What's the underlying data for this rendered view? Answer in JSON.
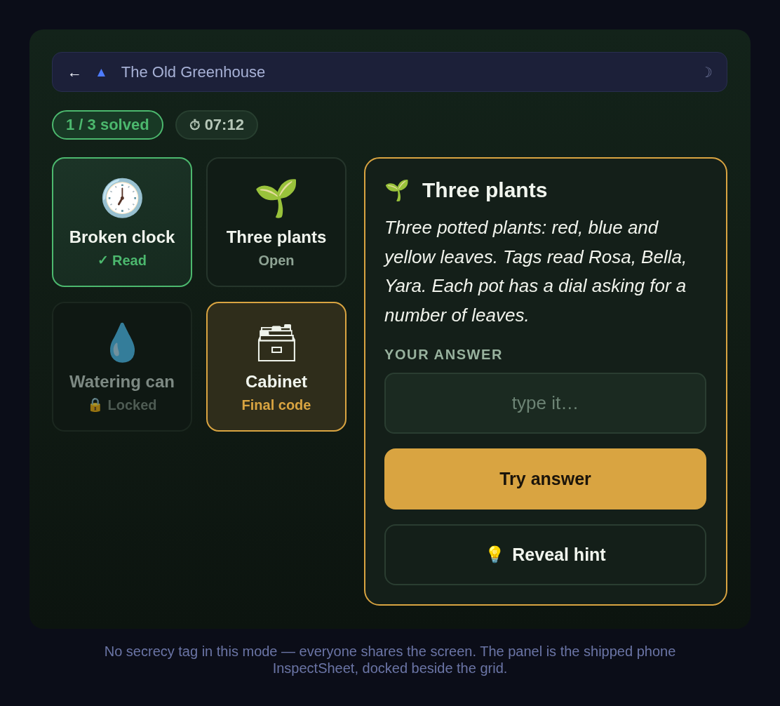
{
  "header": {
    "back": "←",
    "logo": "▲",
    "title": "The Old Greenhouse",
    "theme": "☽"
  },
  "progress": {
    "solved": "1 / 3 solved",
    "timer_icon": "⏱",
    "timer": "07:12"
  },
  "cards": [
    {
      "kind": "solved",
      "icon": "🕖",
      "title": "Broken clock",
      "status_icon": "✓",
      "status": "Read"
    },
    {
      "kind": "open",
      "icon": "🌱",
      "title": "Three plants",
      "status": "Open"
    },
    {
      "kind": "locked",
      "icon": "💧",
      "title": "Watering can",
      "status_icon": "🔒",
      "status": "Locked"
    },
    {
      "kind": "final",
      "icon": "🗃",
      "title": "Cabinet",
      "status": "Final code"
    }
  ],
  "panel": {
    "icon": "🌱",
    "title": "Three plants",
    "description": "Three potted plants: red, blue and yellow leaves. Tags read Rosa, Bella, Yara. Each pot has a dial asking for a number of leaves.",
    "answer_label": "YOUR ANSWER",
    "answer": {
      "placeholder": "type it…"
    },
    "submit": "Try answer",
    "hint": {
      "icon": "💡",
      "label": "Reveal hint"
    }
  },
  "footer": "No secrecy tag in this mode — everyone shares the screen. The panel is the shipped phone InspectSheet, docked beside the grid."
}
